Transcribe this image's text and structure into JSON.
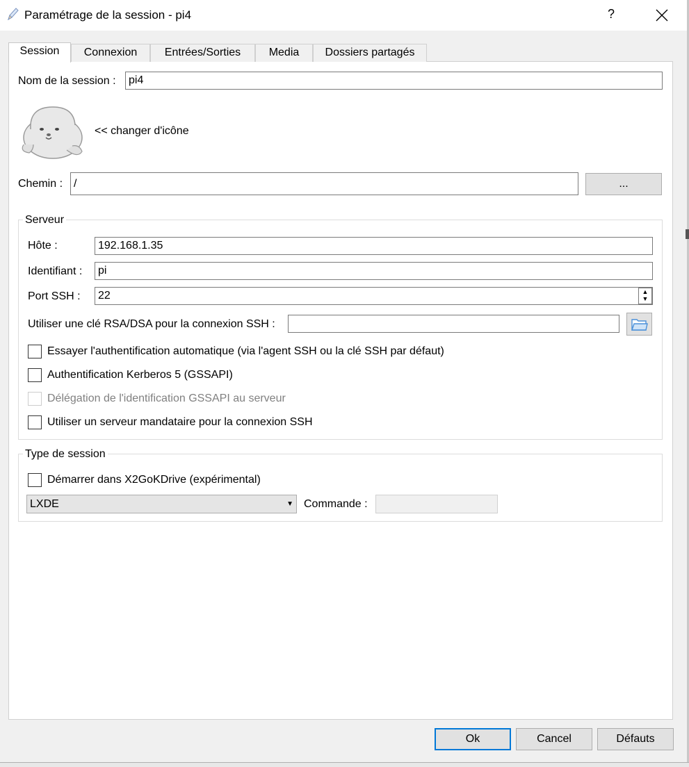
{
  "window": {
    "title": "Paramétrage de la session - pi4",
    "help_label": "?",
    "close_label": "✕"
  },
  "tabs": [
    {
      "label": "Session",
      "active": true
    },
    {
      "label": "Connexion"
    },
    {
      "label": "Entrées/Sorties"
    },
    {
      "label": "Media"
    },
    {
      "label": "Dossiers partagés"
    }
  ],
  "session": {
    "name_label": "Nom de la session :",
    "name_value": "pi4",
    "change_icon_label": "<< changer d'icône",
    "path_label": "Chemin :",
    "path_value": "/",
    "browse_label": "..."
  },
  "server": {
    "legend": "Serveur",
    "host_label": "Hôte :",
    "host_value": "192.168.1.35",
    "login_label": "Identifiant :",
    "login_value": "pi",
    "port_label": "Port SSH :",
    "port_value": "22",
    "key_label": "Utiliser une clé RSA/DSA pour la connexion SSH :",
    "key_value": "",
    "checkboxes": [
      {
        "label": "Essayer l'authentification automatique (via l'agent SSH ou la clé SSH par défaut)",
        "checked": false,
        "enabled": true
      },
      {
        "label": "Authentification Kerberos 5 (GSSAPI)",
        "checked": false,
        "enabled": true
      },
      {
        "label": "Délégation de l'identification GSSAPI au serveur",
        "checked": false,
        "enabled": false
      },
      {
        "label": "Utiliser un serveur mandataire pour la connexion SSH",
        "checked": false,
        "enabled": true
      }
    ]
  },
  "session_type": {
    "legend": "Type de session",
    "x2godrive_label": "Démarrer dans X2GoKDrive (expérimental)",
    "x2godrive_checked": false,
    "type_value": "LXDE",
    "command_label": "Commande :",
    "command_value": ""
  },
  "buttons": {
    "ok": "Ok",
    "cancel": "Cancel",
    "defaults": "Défauts"
  },
  "colors": {
    "accent": "#0078d7",
    "dialog_bg": "#f0f0f0",
    "folder_icon": "#4a90d9"
  }
}
